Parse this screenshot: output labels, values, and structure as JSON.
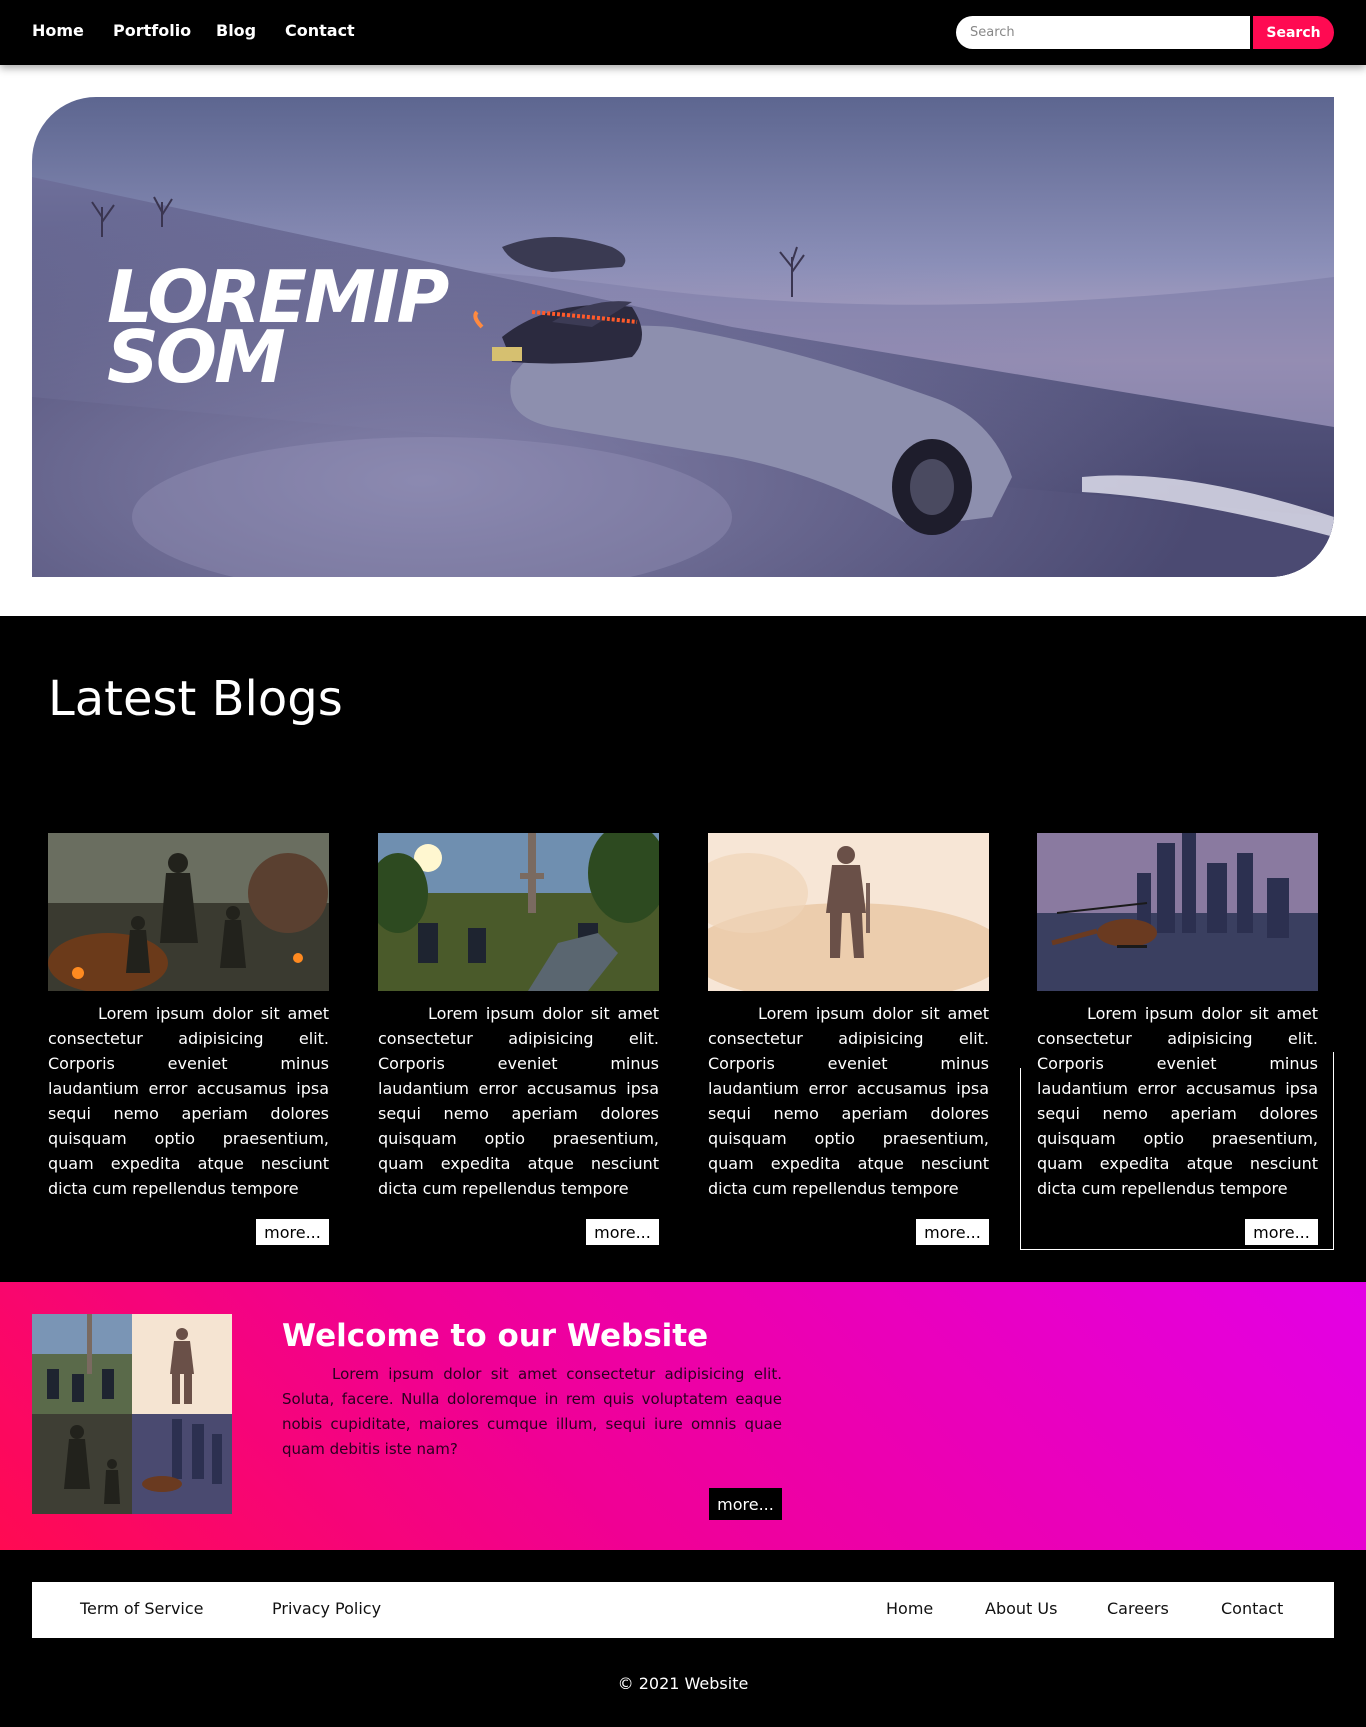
{
  "nav": {
    "links": [
      "Home",
      "Portfolio",
      "Blog",
      "Contact"
    ],
    "search_placeholder": "Search",
    "search_button": "Search"
  },
  "hero": {
    "title_line1": "LOREMIP",
    "title_line2": "SOM"
  },
  "blogs": {
    "title": "Latest Blogs",
    "cards": [
      {
        "image": "soldiers-battlefield",
        "text": "Lorem ipsum dolor sit amet consectetur adipisicing elit. Corporis eveniet minus laudantium error accusamus ipsa sequi nemo aperiam dolores quisquam optio praesentium, quam expedita atque nesciunt dicta cum repellendus tempore",
        "more": "more..."
      },
      {
        "image": "shooter-forest-tower",
        "text": "Lorem ipsum dolor sit amet consectetur adipisicing elit. Corporis eveniet minus laudantium error accusamus ipsa sequi nemo aperiam dolores quisquam optio praesentium, quam expedita atque nesciunt dicta cum repellendus tempore",
        "more": "more..."
      },
      {
        "image": "armored-hero-desert",
        "text": "Lorem ipsum dolor sit amet consectetur adipisicing elit. Corporis eveniet minus laudantium error accusamus ipsa sequi nemo aperiam dolores quisquam optio praesentium, quam expedita atque nesciunt dicta cum repellendus tempore",
        "more": "more..."
      },
      {
        "image": "helicopter-city",
        "text": "Lorem ipsum dolor sit amet consectetur adipisicing elit. Corporis eveniet minus laudantium error accusamus ipsa sequi nemo aperiam dolores quisquam optio praesentium, quam expedita atque nesciunt dicta cum repellendus tempore",
        "more": "more..."
      }
    ]
  },
  "welcome": {
    "title": "Welcome to our Website",
    "text": "Lorem ipsum dolor sit amet consectetur adipisicing elit. Soluta, facere. Nulla doloremque in rem quis voluptatem eaque nobis cupiditate, maiores cumque illum, sequi iure omnis quae quam debitis iste nam?",
    "more": "more..."
  },
  "footer": {
    "left_links": [
      "Term of Service",
      "Privacy Policy"
    ],
    "right_links": [
      "Home",
      "About Us",
      "Careers",
      "Contact"
    ],
    "copyright": "© 2021 Website"
  },
  "colors": {
    "accent": "#ff0a52",
    "gradient_start": "#ff0a52",
    "gradient_end": "#e300e6"
  }
}
